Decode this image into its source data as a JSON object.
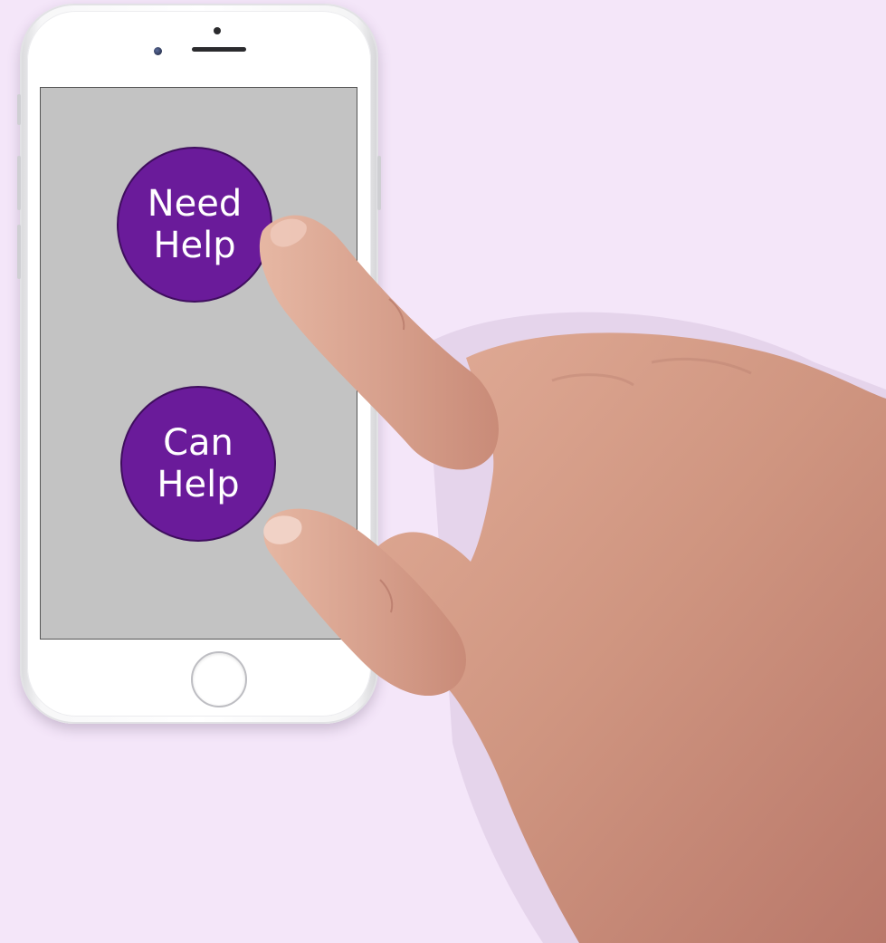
{
  "scene": {
    "background_color": "#f4e6f9"
  },
  "phone": {
    "screen_color": "#c3c3c3",
    "buttons": {
      "need_help": {
        "line1": "Need",
        "line2": "Help",
        "color": "#6a1b9a"
      },
      "can_help": {
        "line1": "Can",
        "line2": "Help",
        "color": "#6a1b9a"
      }
    },
    "icons": {
      "home": "home-button-icon",
      "camera": "front-camera-icon",
      "speaker": "speaker-icon"
    }
  },
  "hand": {
    "skin_color": "#d49a84",
    "icon": "hand-icon"
  }
}
